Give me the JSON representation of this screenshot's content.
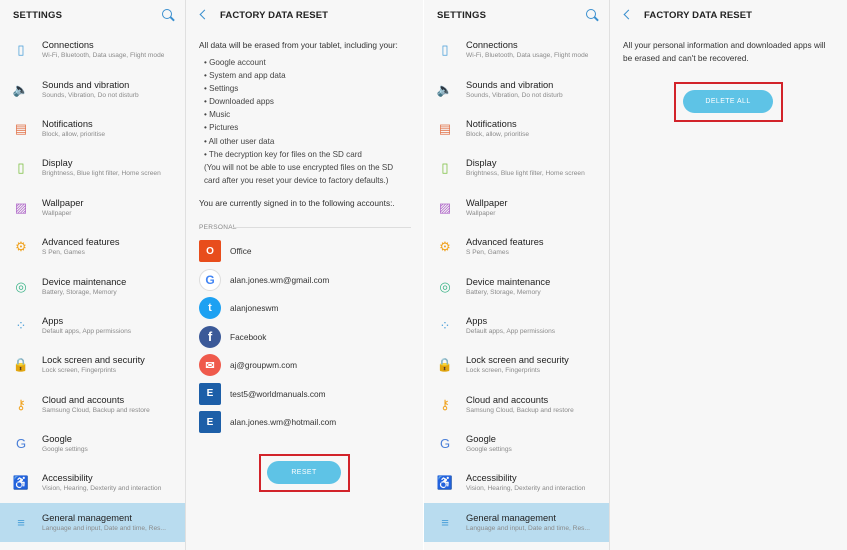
{
  "settings": {
    "title": "SETTINGS",
    "items": [
      {
        "label": "Connections",
        "sub": "Wi-Fi, Bluetooth, Data usage, Flight mode",
        "icon": "connections-icon",
        "glyph": "▯",
        "color": "#4a9fd8"
      },
      {
        "label": "Sounds and vibration",
        "sub": "Sounds, Vibration, Do not disturb",
        "icon": "speaker-icon",
        "glyph": "🔈",
        "color": "#4a9fd8"
      },
      {
        "label": "Notifications",
        "sub": "Block, allow, prioritise",
        "icon": "notifications-icon",
        "glyph": "▤",
        "color": "#e2744b"
      },
      {
        "label": "Display",
        "sub": "Brightness, Blue light filter, Home screen",
        "icon": "display-icon",
        "glyph": "▯",
        "color": "#7bbf3f"
      },
      {
        "label": "Wallpaper",
        "sub": "Wallpaper",
        "icon": "wallpaper-icon",
        "glyph": "▨",
        "color": "#b06ac9"
      },
      {
        "label": "Advanced features",
        "sub": "S Pen, Games",
        "icon": "gear-icon",
        "glyph": "⚙",
        "color": "#f0a21e"
      },
      {
        "label": "Device maintenance",
        "sub": "Battery, Storage, Memory",
        "icon": "maintenance-icon",
        "glyph": "◎",
        "color": "#3fb58a"
      },
      {
        "label": "Apps",
        "sub": "Default apps, App permissions",
        "icon": "apps-icon",
        "glyph": "⁘",
        "color": "#4a9fd8"
      },
      {
        "label": "Lock screen and security",
        "sub": "Lock screen, Fingerprints",
        "icon": "lock-icon",
        "glyph": "🔒",
        "color": "#6a8fa8"
      },
      {
        "label": "Cloud and accounts",
        "sub": "Samsung Cloud, Backup and restore",
        "icon": "key-icon",
        "glyph": "⚷",
        "color": "#f0a21e"
      },
      {
        "label": "Google",
        "sub": "Google settings",
        "icon": "google-icon",
        "glyph": "G",
        "color": "#4a7fd8"
      },
      {
        "label": "Accessibility",
        "sub": "Vision, Hearing, Dexterity and interaction",
        "icon": "accessibility-icon",
        "glyph": "♿",
        "color": "#7bbf3f"
      },
      {
        "label": "General management",
        "sub": "Language and input, Date and time, Res...",
        "icon": "sliders-icon",
        "glyph": "≡",
        "color": "#4a9fd8"
      }
    ]
  },
  "left_detail": {
    "title": "FACTORY DATA RESET",
    "intro": "All data will be erased from your tablet, including your:",
    "bullets": [
      "• Google account",
      "• System and app data",
      "• Settings",
      "• Downloaded apps",
      "• Music",
      "• Pictures",
      "• All other user data",
      "• The decryption key for files on the SD card"
    ],
    "note": "(You will not be able to use encrypted files on the SD card after you reset your device to factory defaults.)",
    "signed_in": "You are currently signed in to the following accounts:.",
    "section": "PERSONAL",
    "accounts": [
      {
        "name": "Office",
        "logo": "office-logo-icon",
        "glyph": "O"
      },
      {
        "name": "alan.jones.wm@gmail.com",
        "logo": "google-logo-icon",
        "glyph": "G"
      },
      {
        "name": "alanjoneswm",
        "logo": "twitter-logo-icon",
        "glyph": "t"
      },
      {
        "name": "Facebook",
        "logo": "facebook-logo-icon",
        "glyph": "f"
      },
      {
        "name": "aj@groupwm.com",
        "logo": "mail-logo-icon",
        "glyph": "✉"
      },
      {
        "name": "test5@worldmanuals.com",
        "logo": "exchange-logo-icon",
        "glyph": "E"
      },
      {
        "name": "alan.jones.wm@hotmail.com",
        "logo": "exchange-logo-icon",
        "glyph": "E"
      }
    ],
    "reset_label": "RESET"
  },
  "right_detail": {
    "title": "FACTORY DATA RESET",
    "text": "All your personal information and downloaded apps will be erased and can't be recovered.",
    "delete_label": "DELETE ALL"
  },
  "colors": {
    "accent": "#5ec3e6",
    "highlight": "#d2232a",
    "active_row": "#b9dcef"
  }
}
